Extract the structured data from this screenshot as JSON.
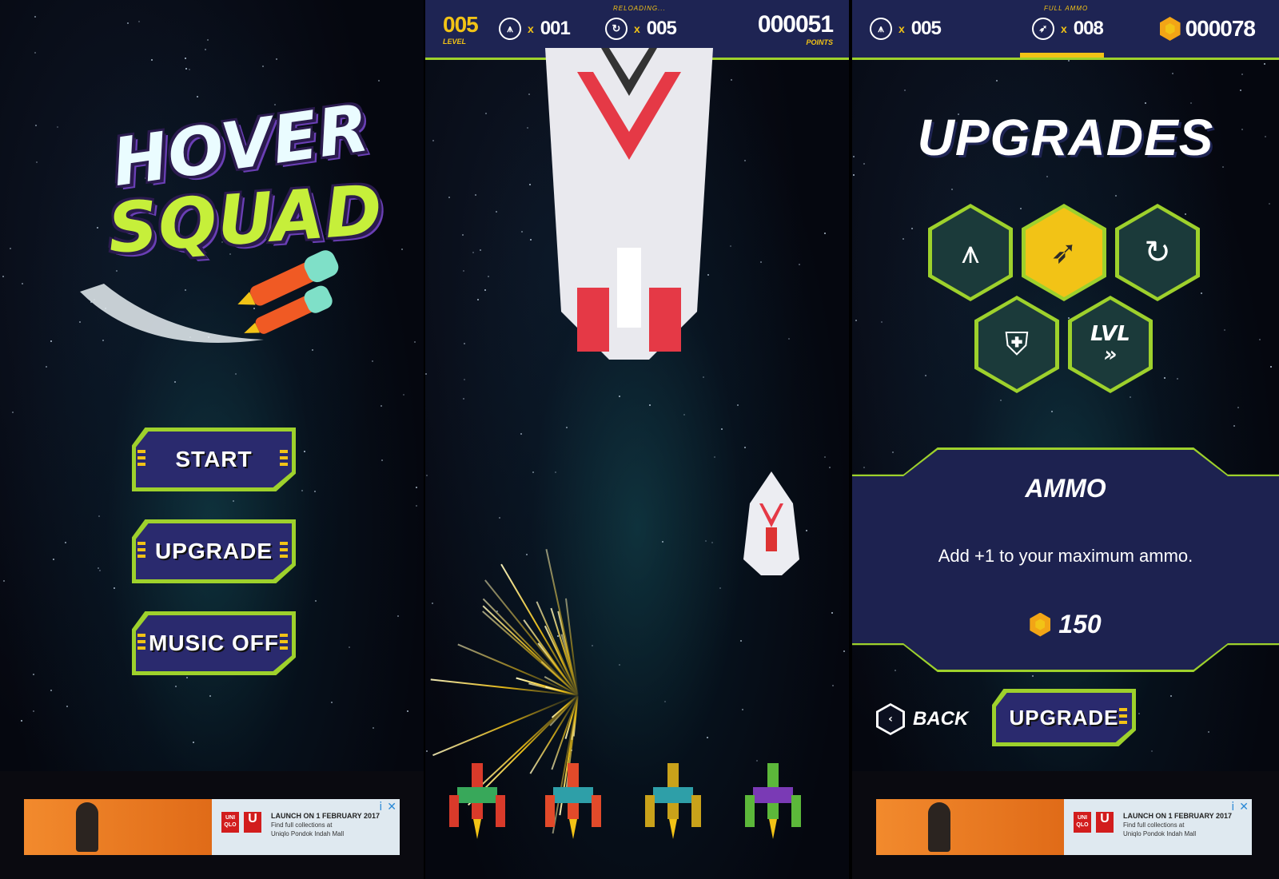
{
  "menu": {
    "logo_line1": "HOVER",
    "logo_line2": "SQUAD",
    "start_label": "START",
    "upgrade_label": "UPGRADE",
    "music_label": "MUSIC OFF"
  },
  "ad": {
    "brand_top": "UNI QLO",
    "brand_u": "U",
    "headline": "LAUNCH ON 1 FEBRUARY 2017",
    "line1": "Find full collections at",
    "line2": "Uniqlo Pondok Indah Mall",
    "info_icon": "i",
    "close_icon": "✕"
  },
  "game_hud": {
    "level_value": "005",
    "level_label": "LEVEL",
    "ships_x": "x",
    "ships_value": "001",
    "reload_label": "RELOADING...",
    "ammo_x": "x",
    "ammo_value": "005",
    "points_value": "000051",
    "points_label": "POINTS"
  },
  "upgrade_hud": {
    "ships_x": "x",
    "ships_value": "005",
    "ammo_label": "FULL AMMO",
    "ammo_x": "x",
    "ammo_value": "008",
    "coins_value": "000078"
  },
  "upgrades": {
    "title": "UPGRADES",
    "hex_lvl": "LVL",
    "selected_title": "AMMO",
    "selected_desc": "Add +1 to your maximum ammo.",
    "selected_cost": "150",
    "back_label": "BACK",
    "upgrade_label": "UPGRADE"
  },
  "colors": {
    "accent_green": "#9ed12c",
    "accent_yellow": "#f2c316",
    "panel_navy": "#1e2453"
  }
}
